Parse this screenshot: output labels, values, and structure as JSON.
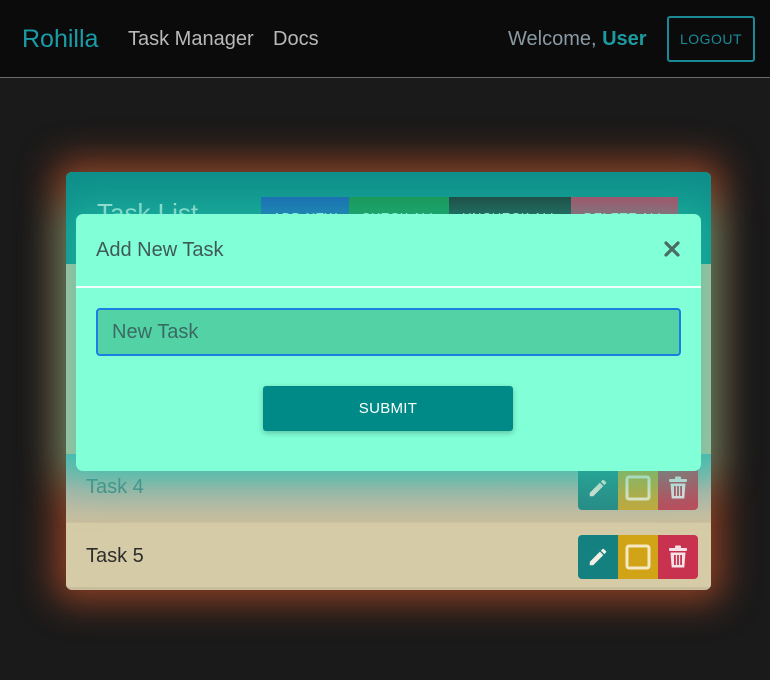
{
  "navbar": {
    "brand": "Rohilla",
    "links": [
      "Task Manager",
      "Docs"
    ],
    "welcome_prefix": "Welcome, ",
    "username": "User",
    "logout_label": "LOGOUT"
  },
  "task_list": {
    "title": "Task List",
    "header_buttons": {
      "add": "ADD NEW",
      "check_all": "CHECK ALL",
      "uncheck_all": "UNCHECK ALL",
      "delete_all": "DELETE ALL"
    },
    "tasks": [
      {
        "label": "Task 4",
        "checked": false
      },
      {
        "label": "Task 5",
        "checked": false
      }
    ]
  },
  "modal": {
    "title": "Add New Task",
    "input_placeholder": "New Task",
    "submit_label": "SUBMIT"
  },
  "colors": {
    "brand": "#1a9ba8",
    "modal_bg": "#81ffd7",
    "submit": "#008a87",
    "edit": "#14807f",
    "check": "#d1a316",
    "delete": "#c8324f"
  },
  "icons": {
    "close": "close-icon",
    "edit": "pencil-icon",
    "checkbox": "checkbox-icon",
    "delete": "trash-icon"
  }
}
